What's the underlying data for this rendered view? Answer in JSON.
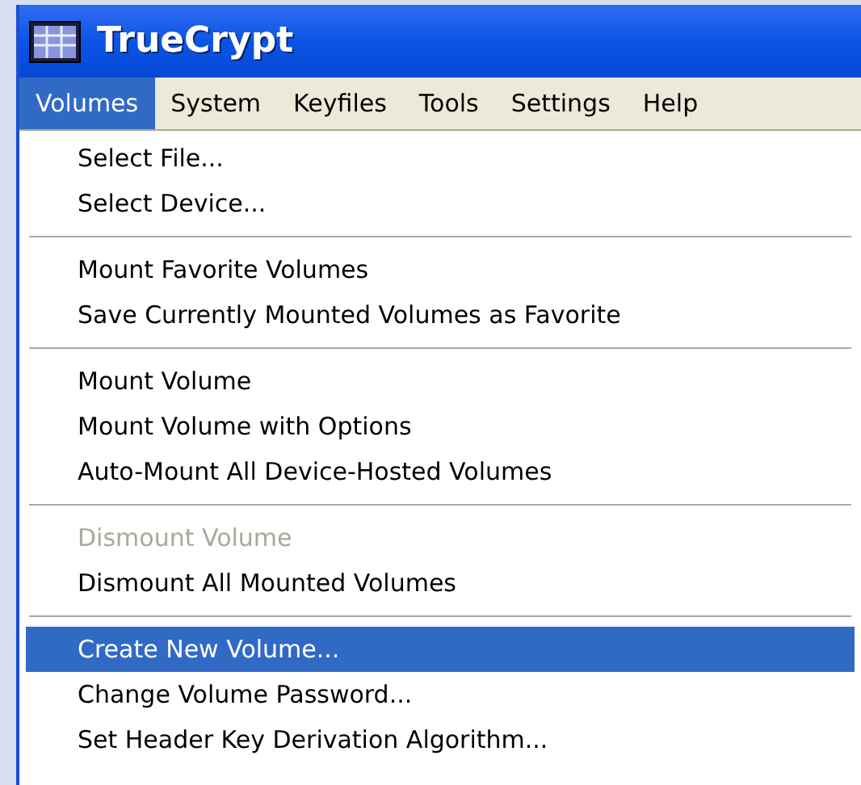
{
  "window": {
    "title": "TrueCrypt"
  },
  "menubar": [
    {
      "label": "Volumes",
      "selected": true
    },
    {
      "label": "System",
      "selected": false
    },
    {
      "label": "Keyfiles",
      "selected": false
    },
    {
      "label": "Tools",
      "selected": false
    },
    {
      "label": "Settings",
      "selected": false
    },
    {
      "label": "Help",
      "selected": false
    }
  ],
  "menu": [
    [
      {
        "label": "Select File...",
        "disabled": false,
        "selected": false
      },
      {
        "label": "Select Device...",
        "disabled": false,
        "selected": false
      }
    ],
    [
      {
        "label": "Mount Favorite Volumes",
        "disabled": false,
        "selected": false
      },
      {
        "label": "Save Currently Mounted Volumes as Favorite",
        "disabled": false,
        "selected": false
      }
    ],
    [
      {
        "label": "Mount Volume",
        "disabled": false,
        "selected": false
      },
      {
        "label": "Mount Volume with Options",
        "disabled": false,
        "selected": false
      },
      {
        "label": "Auto-Mount All Device-Hosted Volumes",
        "disabled": false,
        "selected": false
      }
    ],
    [
      {
        "label": "Dismount Volume",
        "disabled": true,
        "selected": false
      },
      {
        "label": "Dismount All Mounted Volumes",
        "disabled": false,
        "selected": false
      }
    ],
    [
      {
        "label": "Create New Volume...",
        "disabled": false,
        "selected": true
      },
      {
        "label": "Change Volume Password...",
        "disabled": false,
        "selected": false
      },
      {
        "label": "Set Header Key Derivation Algorithm...",
        "disabled": false,
        "selected": false
      }
    ]
  ]
}
